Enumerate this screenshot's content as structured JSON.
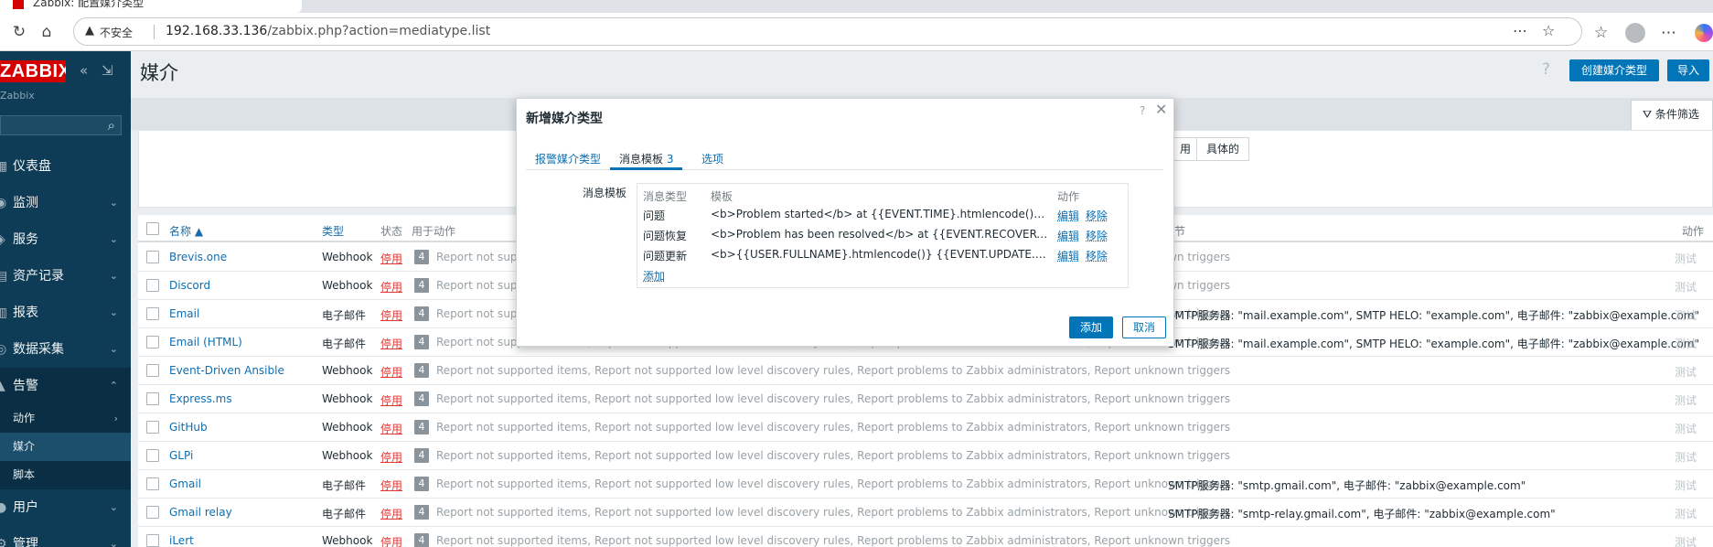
{
  "browser": {
    "tab_title": "Zabbix: 配置媒介类型",
    "insecure_label": "不安全",
    "url_host": "192.168.33.136",
    "url_path": "/zabbix.php?action=mediatype.list"
  },
  "sidebar": {
    "logo": "ZABBIX",
    "server_name": "Zabbix",
    "menu": [
      {
        "label": "仪表盘",
        "icon": "dashboard-icon"
      },
      {
        "label": "监测",
        "icon": "monitoring-icon"
      },
      {
        "label": "服务",
        "icon": "services-icon"
      },
      {
        "label": "资产记录",
        "icon": "inventory-icon"
      },
      {
        "label": "报表",
        "icon": "reports-icon"
      },
      {
        "label": "数据采集",
        "icon": "data-collection-icon"
      },
      {
        "label": "告警",
        "icon": "alerts-icon"
      }
    ],
    "submenu": [
      {
        "label": "动作"
      },
      {
        "label": "媒介"
      },
      {
        "label": "脚本"
      }
    ],
    "menu_after": [
      {
        "label": "用户",
        "icon": "users-icon"
      },
      {
        "label": "管理",
        "icon": "administration-icon"
      }
    ]
  },
  "page": {
    "title": "媒介",
    "create_button": "创建媒介类型",
    "import_button": "导入",
    "filter_tab": "条件筛选",
    "filter_seg_partial": "用",
    "filter_seg_specific": "具体的"
  },
  "table": {
    "headers": {
      "name": "名称 ▲",
      "type": "类型",
      "status": "状态",
      "used_in_actions": "用于动作",
      "details": "细节",
      "action": "动作"
    },
    "rows": [
      {
        "name": "Brevis.one",
        "type": "Webhook",
        "status": "停用",
        "count": "4",
        "actions": "Report not supported items, Report not supported low level discovery rules, Report problems to Zabbix administrators, Report unknown triggers",
        "details": "",
        "test": "测试"
      },
      {
        "name": "Discord",
        "type": "Webhook",
        "status": "停用",
        "count": "4",
        "actions": "Report not supported items, Report not supported low level discovery rules, Report problems to Zabbix administrators, Report unknown triggers",
        "details": "",
        "test": "测试"
      },
      {
        "name": "Email",
        "type": "电子邮件",
        "status": "停用",
        "count": "4",
        "actions": "Report not supported items, Report not supported low level discovery rules, Report problems to Zabbix administrators, Report unknown triggers",
        "details": "SMTP服务器: \"mail.example.com\", SMTP HELO: \"example.com\", 电子邮件: \"zabbix@example.com\"",
        "test": "测试"
      },
      {
        "name": "Email (HTML)",
        "type": "电子邮件",
        "status": "停用",
        "count": "4",
        "actions": "Report not supported items, Report not supported low level discovery rules, Report problems to Zabbix administrators, Report unknown triggers",
        "details": "SMTP服务器: \"mail.example.com\", SMTP HELO: \"example.com\", 电子邮件: \"zabbix@example.com\"",
        "test": "测试"
      },
      {
        "name": "Event-Driven Ansible",
        "type": "Webhook",
        "status": "停用",
        "count": "4",
        "actions": "Report not supported items, Report not supported low level discovery rules, Report problems to Zabbix administrators, Report unknown triggers",
        "details": "",
        "test": "测试"
      },
      {
        "name": "Express.ms",
        "type": "Webhook",
        "status": "停用",
        "count": "4",
        "actions": "Report not supported items, Report not supported low level discovery rules, Report problems to Zabbix administrators, Report unknown triggers",
        "details": "",
        "test": "测试"
      },
      {
        "name": "GitHub",
        "type": "Webhook",
        "status": "停用",
        "count": "4",
        "actions": "Report not supported items, Report not supported low level discovery rules, Report problems to Zabbix administrators, Report unknown triggers",
        "details": "",
        "test": "测试"
      },
      {
        "name": "GLPi",
        "type": "Webhook",
        "status": "停用",
        "count": "4",
        "actions": "Report not supported items, Report not supported low level discovery rules, Report problems to Zabbix administrators, Report unknown triggers",
        "details": "",
        "test": "测试"
      },
      {
        "name": "Gmail",
        "type": "电子邮件",
        "status": "停用",
        "count": "4",
        "actions": "Report not supported items, Report not supported low level discovery rules, Report problems to Zabbix administrators, Report unknown triggers",
        "details": "SMTP服务器: \"smtp.gmail.com\", 电子邮件: \"zabbix@example.com\"",
        "test": "测试"
      },
      {
        "name": "Gmail relay",
        "type": "电子邮件",
        "status": "停用",
        "count": "4",
        "actions": "Report not supported items, Report not supported low level discovery rules, Report problems to Zabbix administrators, Report unknown triggers",
        "details": "SMTP服务器: \"smtp-relay.gmail.com\", 电子邮件: \"zabbix@example.com\"",
        "test": "测试"
      },
      {
        "name": "iLert",
        "type": "Webhook",
        "status": "停用",
        "count": "4",
        "actions": "Report not supported items, Report not supported low level discovery rules, Report problems to Zabbix administrators, Report unknown triggers",
        "details": "",
        "test": "测试"
      }
    ]
  },
  "modal": {
    "title": "新增媒介类型",
    "help": "?",
    "tabs": {
      "media_type": "报警媒介类型",
      "message_templates": "消息模板",
      "message_templates_count": "3",
      "options": "选项"
    },
    "form_label": "消息模板",
    "templates_headers": {
      "type": "消息类型",
      "template": "模板",
      "action": "动作"
    },
    "templates": [
      {
        "type": "问题",
        "template": "<b>Problem started</b> at {{EVENT.TIME}.htmlencode()} on {{EVENT.DATE}.htmlencode()}",
        "edit": "编辑",
        "remove": "移除"
      },
      {
        "type": "问题恢复",
        "template": "<b>Problem has been resolved</b> at {{EVENT.RECOVERY.TIME}.htmlencode()} on {{EVENT.RECOVERY.DATE}.htmlencode()}",
        "edit": "编辑",
        "remove": "移除"
      },
      {
        "type": "问题更新",
        "template": "<b>{{USER.FULLNAME}.htmlencode()} {{EVENT.UPDATE.ACTION}.htmlencode()} problem</b>",
        "edit": "编辑",
        "remove": "移除"
      }
    ],
    "add_template_link": "添加",
    "add_button": "添加",
    "cancel_button": "取消"
  },
  "colors": {
    "sidebar_bg": "#0e3c56",
    "brand_red": "#d40000",
    "primary_blue": "#0275b8",
    "link_blue": "#0e6eb1",
    "disabled_red": "#e33734"
  }
}
